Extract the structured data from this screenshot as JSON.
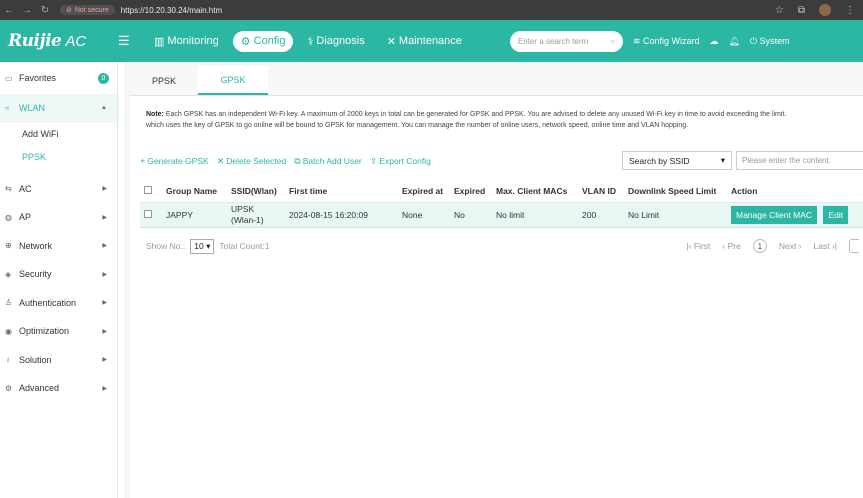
{
  "browser": {
    "security_label": "Not secure",
    "url": "https://10.20.30.24/main.htm"
  },
  "header": {
    "logo_brand": "Ruijie",
    "logo_product": "AC",
    "nav": [
      {
        "label": "Monitoring",
        "icon": "chart-icon"
      },
      {
        "label": "Config",
        "icon": "gear-icon"
      },
      {
        "label": "Diagnosis",
        "icon": "stethoscope-icon"
      },
      {
        "label": "Maintenance",
        "icon": "tools-icon"
      }
    ],
    "search_placeholder": "Enter a search term",
    "config_wizard": "Config Wizard",
    "system": "System"
  },
  "sidebar": {
    "favorites": {
      "label": "Favorites",
      "badge": "0"
    },
    "wlan": {
      "label": "WLAN",
      "sub": [
        "Add WiFi",
        "PPSK"
      ]
    },
    "items": [
      "AC",
      "AP",
      "Network",
      "Security",
      "Authentication",
      "Optimization",
      "Solution",
      "Advanced"
    ]
  },
  "tabs": [
    "PPSK",
    "GPSK"
  ],
  "note": {
    "label": "Note:",
    "line1": "Each GPSK has an independent Wi-Fi key. A maximum of 2000 keys in total can be generated for GPSK and PPSK. You are advised to delete any unused Wi-Fi key in time to avoid exceeding the limit.",
    "line2": "which uses the key of GPSK to go online will be bound to GPSK for management. You can manage the number of online users, network speed, online time and VLAN hopping."
  },
  "toolbar": {
    "generate": "Generate GPSK",
    "delete": "Delete Selected",
    "batch_add": "Batch Add User",
    "export": "Export Config",
    "search_by": "Search by SSID",
    "search_placeholder": "Please enter the content."
  },
  "table": {
    "headers": [
      "Group Name",
      "SSID(Wlan)",
      "First time",
      "Expired at",
      "Expired",
      "Max. Client MACs",
      "VLAN ID",
      "Downlink Speed Limit",
      "Action"
    ],
    "rows": [
      {
        "group": "JAPPY",
        "ssid_line1": "UPSK",
        "ssid_line2": "(Wlan-1)",
        "first_time": "2024-08-15 16:20:09",
        "expired_at": "None",
        "expired": "No",
        "max_macs": "No limit",
        "vlan": "200",
        "downlink": "No Limit",
        "action_manage": "Manage Client MAC",
        "action_edit": "Edit"
      }
    ]
  },
  "pager": {
    "show_no_label": "Show No.:",
    "page_size": "10",
    "total": "Total Count:1",
    "first": "First",
    "prev": "Pre",
    "page": "1",
    "next": "Next",
    "last": "Last"
  }
}
